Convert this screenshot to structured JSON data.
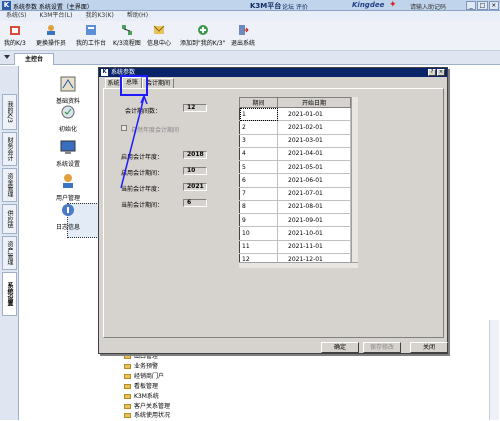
{
  "titlebar": {
    "app_title": "系统参数 系统设置（主界面）",
    "brand": "K3M平台",
    "links": "论坛  评价",
    "kingdee": "Kingdee",
    "search_hint": "请输入助记码"
  },
  "menubar": [
    "系统(S)",
    "K3M平台(L)",
    "我的K3(K)",
    "帮助(H)"
  ],
  "toolbar": [
    {
      "label": "我的K/3",
      "icon": "home-icon"
    },
    {
      "label": "更换操作员",
      "icon": "user-switch-icon"
    },
    {
      "label": "我的工作台",
      "icon": "workbench-icon"
    },
    {
      "label": "K/3流程图",
      "icon": "flowchart-icon"
    },
    {
      "label": "信息中心",
      "icon": "info-center-icon"
    },
    {
      "label": "添加到\"我的K/3\"",
      "icon": "add-favorite-icon"
    },
    {
      "label": "退出系统",
      "icon": "exit-icon"
    }
  ],
  "main_tab": "主控台",
  "left_nav": [
    "我的K/3",
    "财务会计",
    "资金管理",
    "供应链",
    "资产管理",
    "系统设置"
  ],
  "workspace_items": [
    "基础资料",
    "初始化",
    "系统设置",
    "用户管理",
    "日志信息"
  ],
  "tree_items": [
    "出口管理",
    "业务预警",
    "经销商门户",
    "看板管理",
    "K3M系统",
    "客户关系管理",
    "系统使用状况"
  ],
  "dialog": {
    "title": "系统参数",
    "tabs": [
      "系统",
      "总账",
      "会计期间"
    ],
    "active_tab": "总账",
    "fields": [
      {
        "label": "会计期间数：",
        "value": "12"
      },
      {
        "label": "启用会计年度：",
        "value": "2018"
      },
      {
        "label": "启用会计期间：",
        "value": "10"
      },
      {
        "label": "当前会计年度：",
        "value": "2021"
      },
      {
        "label": "当前会计期间：",
        "value": "6"
      }
    ],
    "checkbox_label": "自然年度会计期间",
    "table_headers": [
      "期间",
      "开始日期"
    ],
    "periods": [
      {
        "n": "1",
        "d": "2021-01-01"
      },
      {
        "n": "2",
        "d": "2021-02-01"
      },
      {
        "n": "3",
        "d": "2021-03-01"
      },
      {
        "n": "4",
        "d": "2021-04-01"
      },
      {
        "n": "5",
        "d": "2021-05-01"
      },
      {
        "n": "6",
        "d": "2021-06-01"
      },
      {
        "n": "7",
        "d": "2021-07-01"
      },
      {
        "n": "8",
        "d": "2021-08-01"
      },
      {
        "n": "9",
        "d": "2021-09-01"
      },
      {
        "n": "10",
        "d": "2021-10-01"
      },
      {
        "n": "11",
        "d": "2021-11-01"
      },
      {
        "n": "12",
        "d": "2021-12-01"
      }
    ],
    "buttons": {
      "ok": "确定",
      "save": "保存修改",
      "close": "关闭"
    }
  },
  "colors": {
    "annotation": "#1c1cff",
    "dialog_title": "#0a246a"
  }
}
